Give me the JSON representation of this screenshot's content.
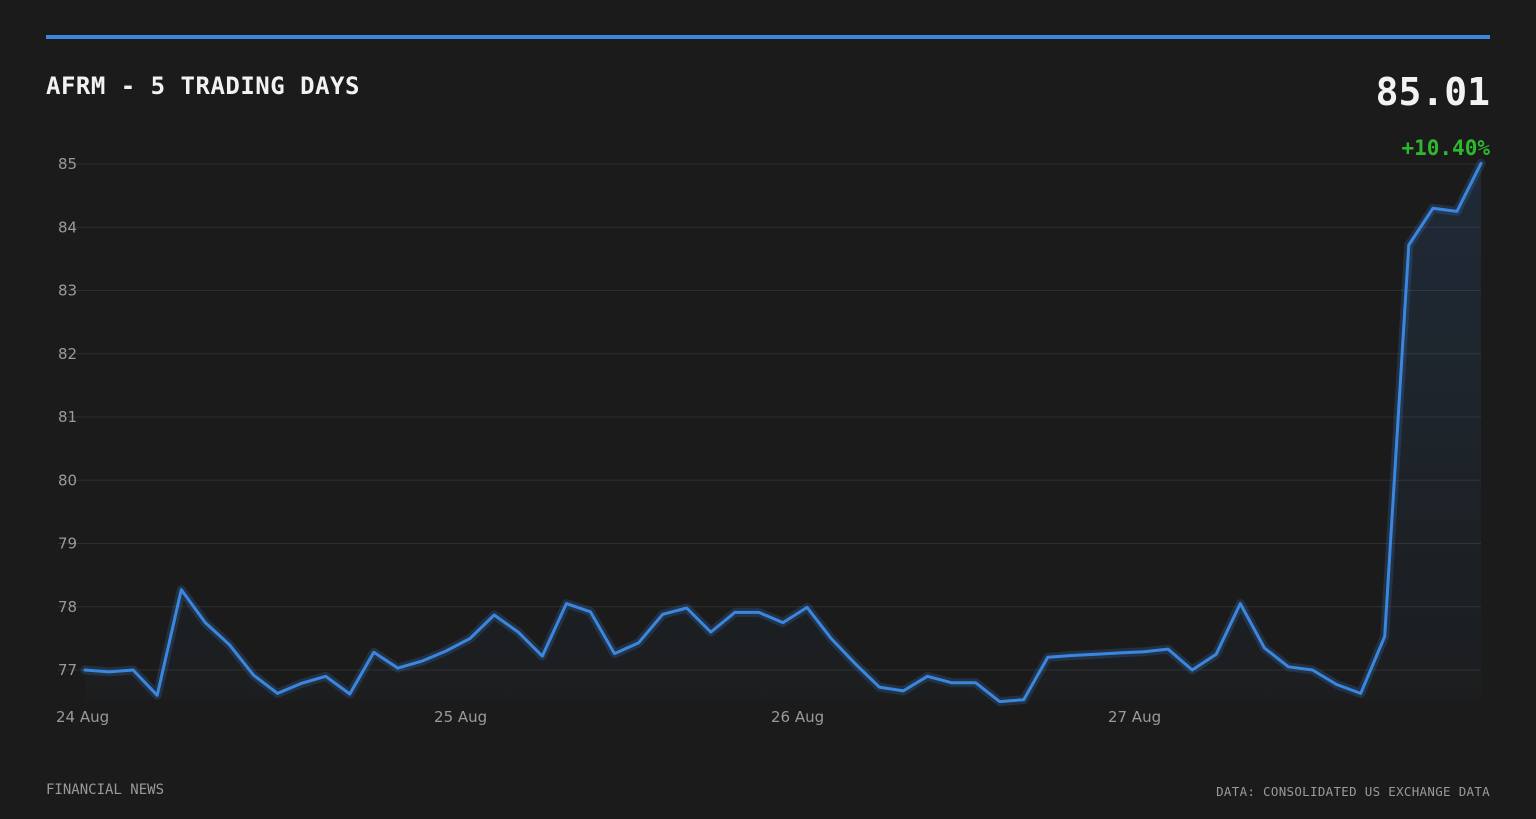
{
  "header": {
    "title": "AFRM - 5 TRADING DAYS",
    "price": "85.01",
    "change": "+10.40%"
  },
  "footer": {
    "source_left": "FINANCIAL NEWS",
    "source_right": "DATA: CONSOLIDATED US EXCHANGE DATA"
  },
  "colors": {
    "accent": "#3b87e0",
    "positive": "#2db82d",
    "background": "#1b1b1b",
    "grid": "#2e2e2e"
  },
  "chart_data": {
    "type": "line",
    "title": "AFRM - 5 TRADING DAYS",
    "xlabel": "",
    "ylabel": "",
    "ylim": [
      76.6,
      85.0
    ],
    "yticks": [
      77,
      78,
      79,
      80,
      81,
      82,
      83,
      84,
      85
    ],
    "xtick_labels": [
      {
        "label": "24 Aug",
        "index": 0
      },
      {
        "label": "25 Aug",
        "index": 15
      },
      {
        "label": "26 Aug",
        "index": 29
      },
      {
        "label": "27 Aug",
        "index": 43
      }
    ],
    "grid": true,
    "legend": "none",
    "series": [
      {
        "values": [
          77.0,
          76.97,
          77.0,
          76.6,
          78.27,
          77.75,
          77.4,
          76.92,
          76.63,
          76.79,
          76.9,
          76.62,
          77.28,
          77.03,
          77.14,
          77.3,
          77.5,
          77.87,
          77.6,
          77.22,
          78.05,
          77.92,
          77.26,
          77.43,
          77.88,
          77.98,
          77.6,
          77.91,
          77.91,
          77.75,
          77.99,
          77.5,
          77.1,
          76.73,
          76.67,
          76.9,
          76.8,
          76.8,
          76.5,
          76.53,
          77.2,
          77.23,
          77.25,
          77.27,
          77.29,
          77.33,
          77.0,
          77.25,
          78.05,
          77.35,
          77.05,
          77.0,
          76.77,
          76.63,
          77.53,
          83.72,
          84.3,
          84.25,
          85.01
        ]
      }
    ]
  }
}
